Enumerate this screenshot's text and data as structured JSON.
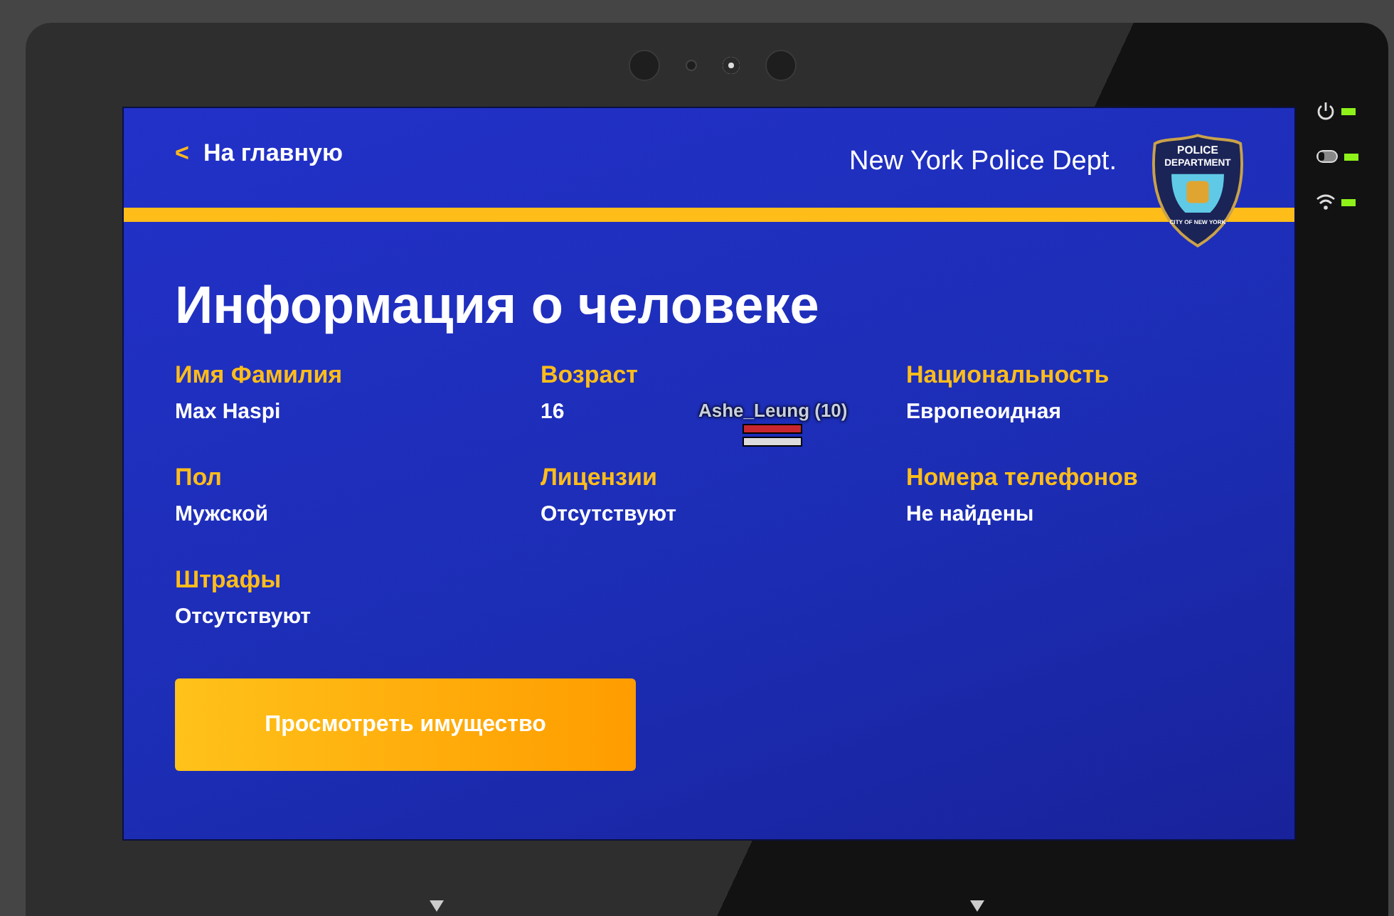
{
  "header": {
    "back_icon": "<",
    "back_label": "На главную",
    "department": "New York Police Dept.",
    "badge": {
      "top": "POLICE",
      "middle": "DEPARTMENT",
      "bottom": "CITY OF NEW YORK"
    }
  },
  "title": "Информация о человеке",
  "fields": [
    {
      "label": "Имя Фамилия",
      "value": "Max Haspi"
    },
    {
      "label": "Возраст",
      "value": "16"
    },
    {
      "label": "Национальность",
      "value": "Европеоидная"
    },
    {
      "label": "Пол",
      "value": "Мужской"
    },
    {
      "label": "Лицензии",
      "value": "Отсутствуют"
    },
    {
      "label": "Номера телефонов",
      "value": "Не найдены"
    },
    {
      "label": "Штрафы",
      "value": "Отсутствуют"
    }
  ],
  "button": "Просмотреть имущество",
  "nametag": {
    "name": "Ashe_Leung (10)",
    "bars": [
      {
        "kind": "health",
        "level": 1
      },
      {
        "kind": "armor",
        "level": 1
      }
    ]
  },
  "indicators": [
    {
      "kind": "power",
      "on": true
    },
    {
      "kind": "battery",
      "on": true
    },
    {
      "kind": "wifi",
      "on": true
    }
  ]
}
